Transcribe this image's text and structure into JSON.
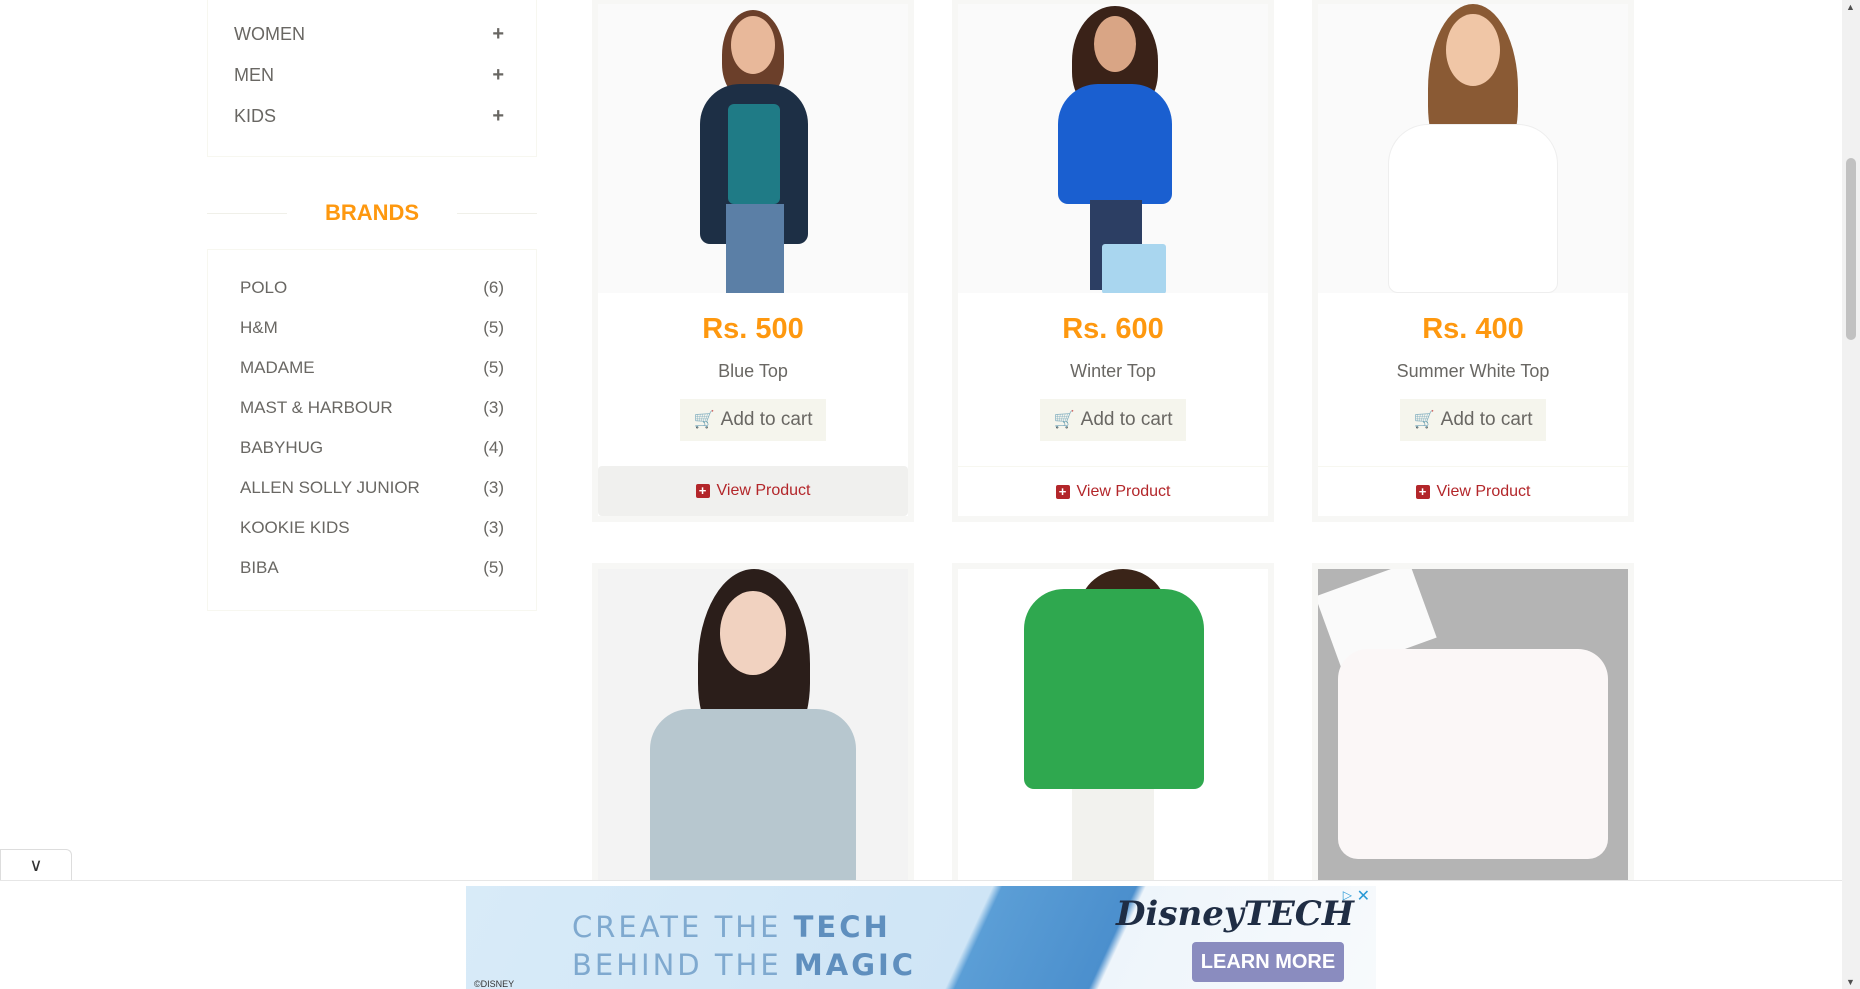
{
  "sidebar": {
    "categories": [
      {
        "label": "WOMEN"
      },
      {
        "label": "MEN"
      },
      {
        "label": "KIDS"
      }
    ],
    "brands_title": "BRANDS",
    "brands": [
      {
        "name": "POLO",
        "count": "(6)"
      },
      {
        "name": "H&M",
        "count": "(5)"
      },
      {
        "name": "MADAME",
        "count": "(5)"
      },
      {
        "name": "MAST & HARBOUR",
        "count": "(3)"
      },
      {
        "name": "BABYHUG",
        "count": "(4)"
      },
      {
        "name": "ALLEN SOLLY JUNIOR",
        "count": "(3)"
      },
      {
        "name": "KOOKIE KIDS",
        "count": "(3)"
      },
      {
        "name": "BIBA",
        "count": "(5)"
      }
    ]
  },
  "products": [
    {
      "price": "Rs. 500",
      "name": "Blue Top",
      "add_label": "Add to cart",
      "view_label": "View Product"
    },
    {
      "price": "Rs. 600",
      "name": "Winter Top",
      "add_label": "Add to cart",
      "view_label": "View Product"
    },
    {
      "price": "Rs. 400",
      "name": "Summer White Top",
      "add_label": "Add to cart",
      "view_label": "View Product"
    }
  ],
  "ad": {
    "headline_line1_a": "CREATE THE ",
    "headline_line1_b": "TECH",
    "headline_line2_a": "BEHIND THE ",
    "headline_line2_b": "MAGIC",
    "logo": "DisneyTECH",
    "cta": "LEARN MORE",
    "copyright": "©DISNEY"
  },
  "colors": {
    "accent": "#fe980f",
    "view_link": "#b3262a",
    "button_bg": "#f5f5ed"
  }
}
